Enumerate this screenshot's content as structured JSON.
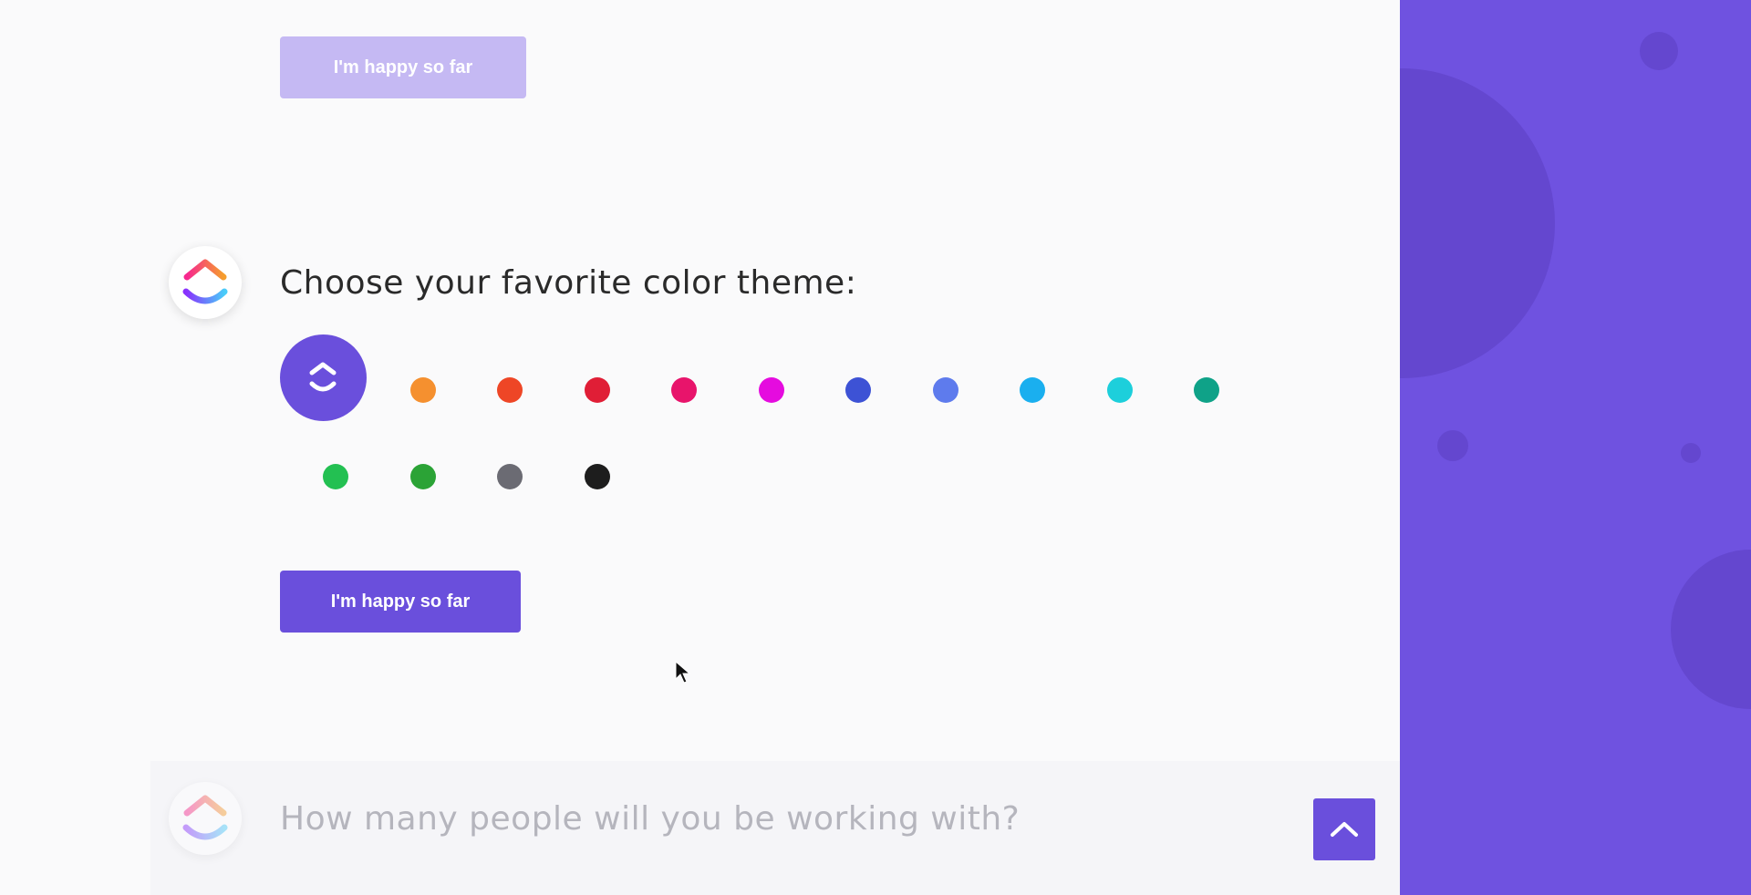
{
  "buttons": {
    "faded_label": "I'm happy so far",
    "primary_label": "I'm happy so far"
  },
  "questions": {
    "color_theme": "Choose your favorite color theme:",
    "people_count": "How many people will you be working with?"
  },
  "color_swatches": [
    {
      "name": "purple",
      "color": "#6a4fdc",
      "selected": true
    },
    {
      "name": "orange",
      "color": "#f5902f"
    },
    {
      "name": "red-orange",
      "color": "#ee4626"
    },
    {
      "name": "red",
      "color": "#e01e36"
    },
    {
      "name": "pink",
      "color": "#e8146b"
    },
    {
      "name": "magenta",
      "color": "#e50bdf"
    },
    {
      "name": "royal-blue",
      "color": "#3d52d5"
    },
    {
      "name": "periwinkle",
      "color": "#5e7bed"
    },
    {
      "name": "sky-blue",
      "color": "#1aafef"
    },
    {
      "name": "cyan",
      "color": "#1dcfdb"
    },
    {
      "name": "teal",
      "color": "#0fa288"
    },
    {
      "name": "green",
      "color": "#23c052"
    },
    {
      "name": "dark-green",
      "color": "#2ba336"
    },
    {
      "name": "gray",
      "color": "#6b6b73"
    },
    {
      "name": "black",
      "color": "#1d1d1d"
    }
  ],
  "colors": {
    "brand": "#6a4fdc",
    "sidebar": "#6f52e0"
  },
  "icons": {
    "logo": "clickup-logo-icon",
    "scroll_up": "chevron-up-icon"
  }
}
